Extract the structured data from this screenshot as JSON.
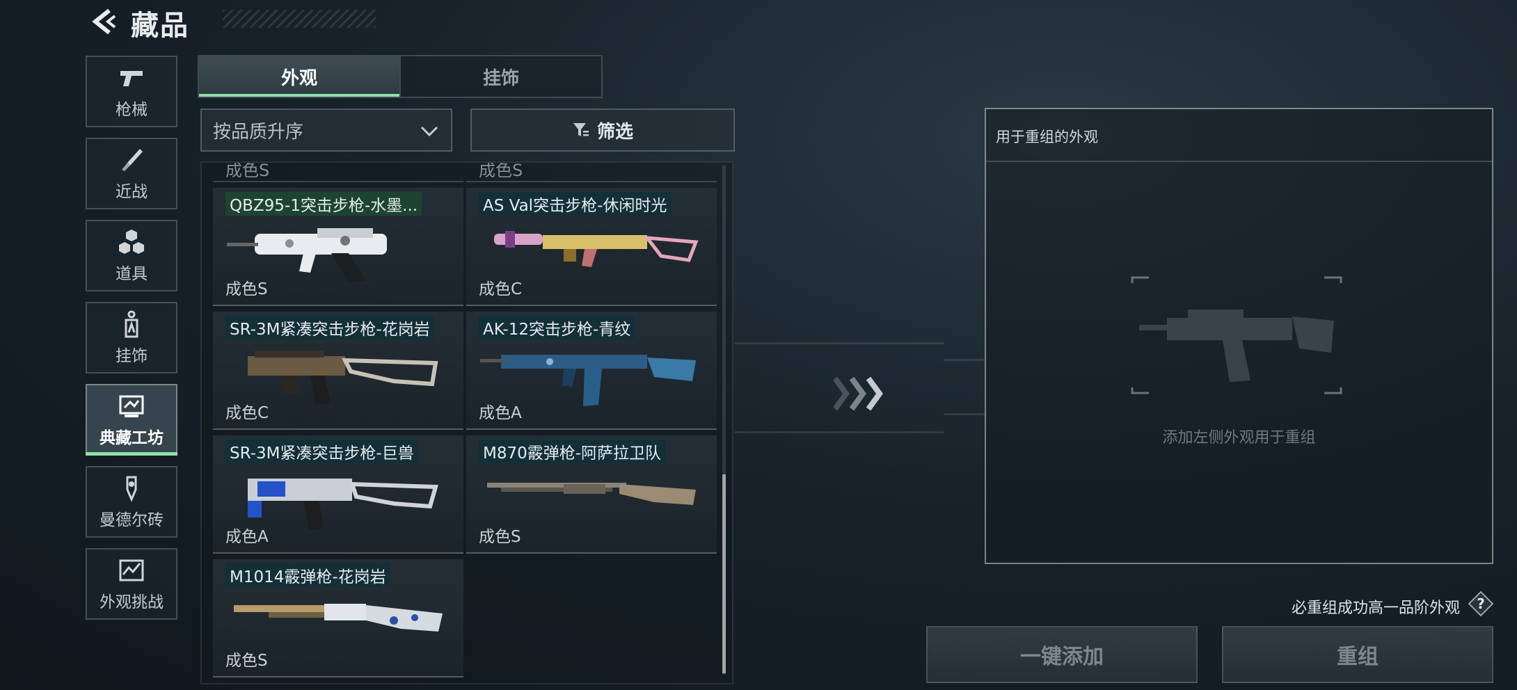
{
  "header": {
    "title": "藏品"
  },
  "sidebar": {
    "items": [
      {
        "label": "枪械",
        "icon": "pistol-icon"
      },
      {
        "label": "近战",
        "icon": "knife-icon"
      },
      {
        "label": "道具",
        "icon": "cubes-icon"
      },
      {
        "label": "挂饰",
        "icon": "charm-icon"
      },
      {
        "label": "典藏工坊",
        "icon": "workshop-icon",
        "active": true
      },
      {
        "label": "曼德尔砖",
        "icon": "mandel-brick-icon"
      },
      {
        "label": "外观挑战",
        "icon": "challenge-icon"
      }
    ]
  },
  "tabs": [
    {
      "label": "外观",
      "active": true
    },
    {
      "label": "挂饰",
      "active": false
    }
  ],
  "sort": {
    "label": "按品质升序"
  },
  "filter": {
    "label": "筛选"
  },
  "list": {
    "partial_label": "成色S",
    "items": [
      {
        "name": "QBZ95-1突击步枪-水墨...",
        "grade": "成色S",
        "selected": true
      },
      {
        "name": "AS Val突击步枪-休闲时光",
        "grade": "成色C",
        "selected": false
      },
      {
        "name": "SR-3M紧凑突击步枪-花岗岩",
        "grade": "成色C",
        "selected": false
      },
      {
        "name": "AK-12突击步枪-青纹",
        "grade": "成色A",
        "selected": false
      },
      {
        "name": "SR-3M紧凑突击步枪-巨兽",
        "grade": "成色A",
        "selected": false
      },
      {
        "name": "M870霰弹枪-阿萨拉卫队",
        "grade": "成色S",
        "selected": false
      },
      {
        "name": "M1014霰弹枪-花岗岩",
        "grade": "成色S",
        "selected": false
      }
    ]
  },
  "right_panel": {
    "title": "用于重组的外观",
    "empty_hint": "添加左侧外观用于重组"
  },
  "guarantee_text": "必重组成功高一品阶外观",
  "buttons": {
    "add_all": "一键添加",
    "recombine": "重组"
  },
  "colors": {
    "accent": "#8fe0a8"
  }
}
